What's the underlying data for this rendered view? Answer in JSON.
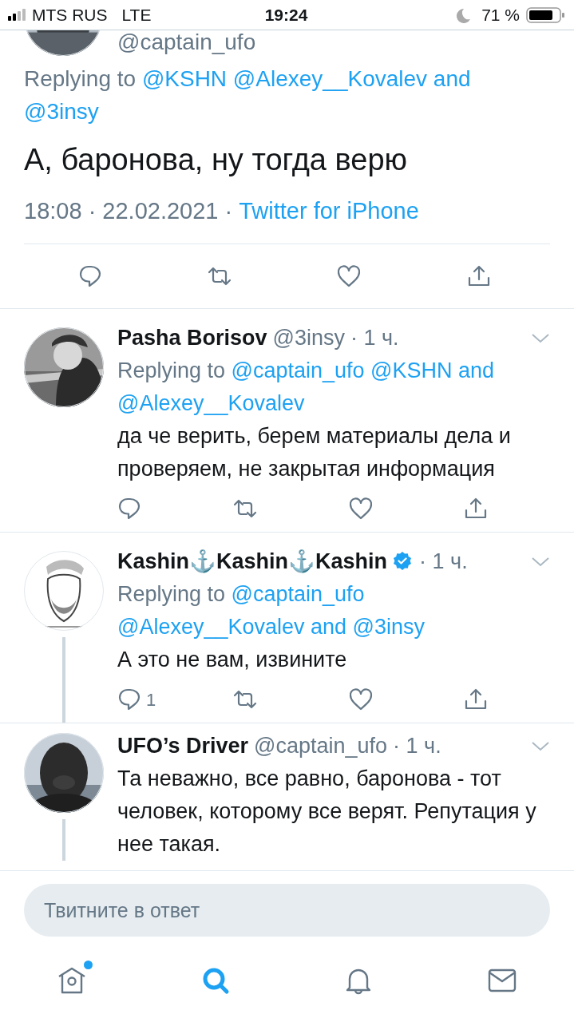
{
  "status_bar": {
    "carrier": "MTS RUS",
    "network": "LTE",
    "time": "19:24",
    "battery": "71 %"
  },
  "main_tweet": {
    "handle": "@captain_ufo",
    "replying": {
      "prefix": "Replying to",
      "to": "@KSHN @Alexey__Kovalev and @3insy"
    },
    "text": "А, баронова, ну тогда верю",
    "timestamp": "18:08 · 22.02.2021 ·",
    "source": "Twitter for iPhone"
  },
  "replies": [
    {
      "name": "Pasha Borisov",
      "verified": false,
      "handle": "@3insy",
      "time": "· 1 ч.",
      "replying": {
        "prefix": "Replying to",
        "to": "@captain_ufo @KSHN and @Alexey__Kovalev"
      },
      "text": "да че верить, берем материалы дела и проверяем, не закрытая информация",
      "thread_line": false
    },
    {
      "name": "Kashin⚓Kashin⚓Kashin",
      "verified": true,
      "time": "· 1 ч.",
      "replying": {
        "prefix": "Replying to",
        "to": "@captain_ufo @Alexey__Kovalev and @3insy"
      },
      "text": "А это не вам, извините",
      "reply_count": "1",
      "thread_line": true
    },
    {
      "name": "UFO’s Driver",
      "verified": false,
      "handle": "@captain_ufo",
      "time": "· 1 ч.",
      "text": "Та неважно, все равно, баронова - тот человек, которому все верят. Репутация у нее такая.",
      "thread_line": true
    }
  ],
  "compose": {
    "placeholder": "Твитните в ответ"
  },
  "tab_bar": [
    {
      "kind": "home",
      "selected": false,
      "badge": true
    },
    {
      "kind": "search",
      "selected": true,
      "badge": false
    },
    {
      "kind": "notifications",
      "selected": false,
      "badge": false
    },
    {
      "kind": "messages",
      "selected": false,
      "badge": false
    }
  ]
}
